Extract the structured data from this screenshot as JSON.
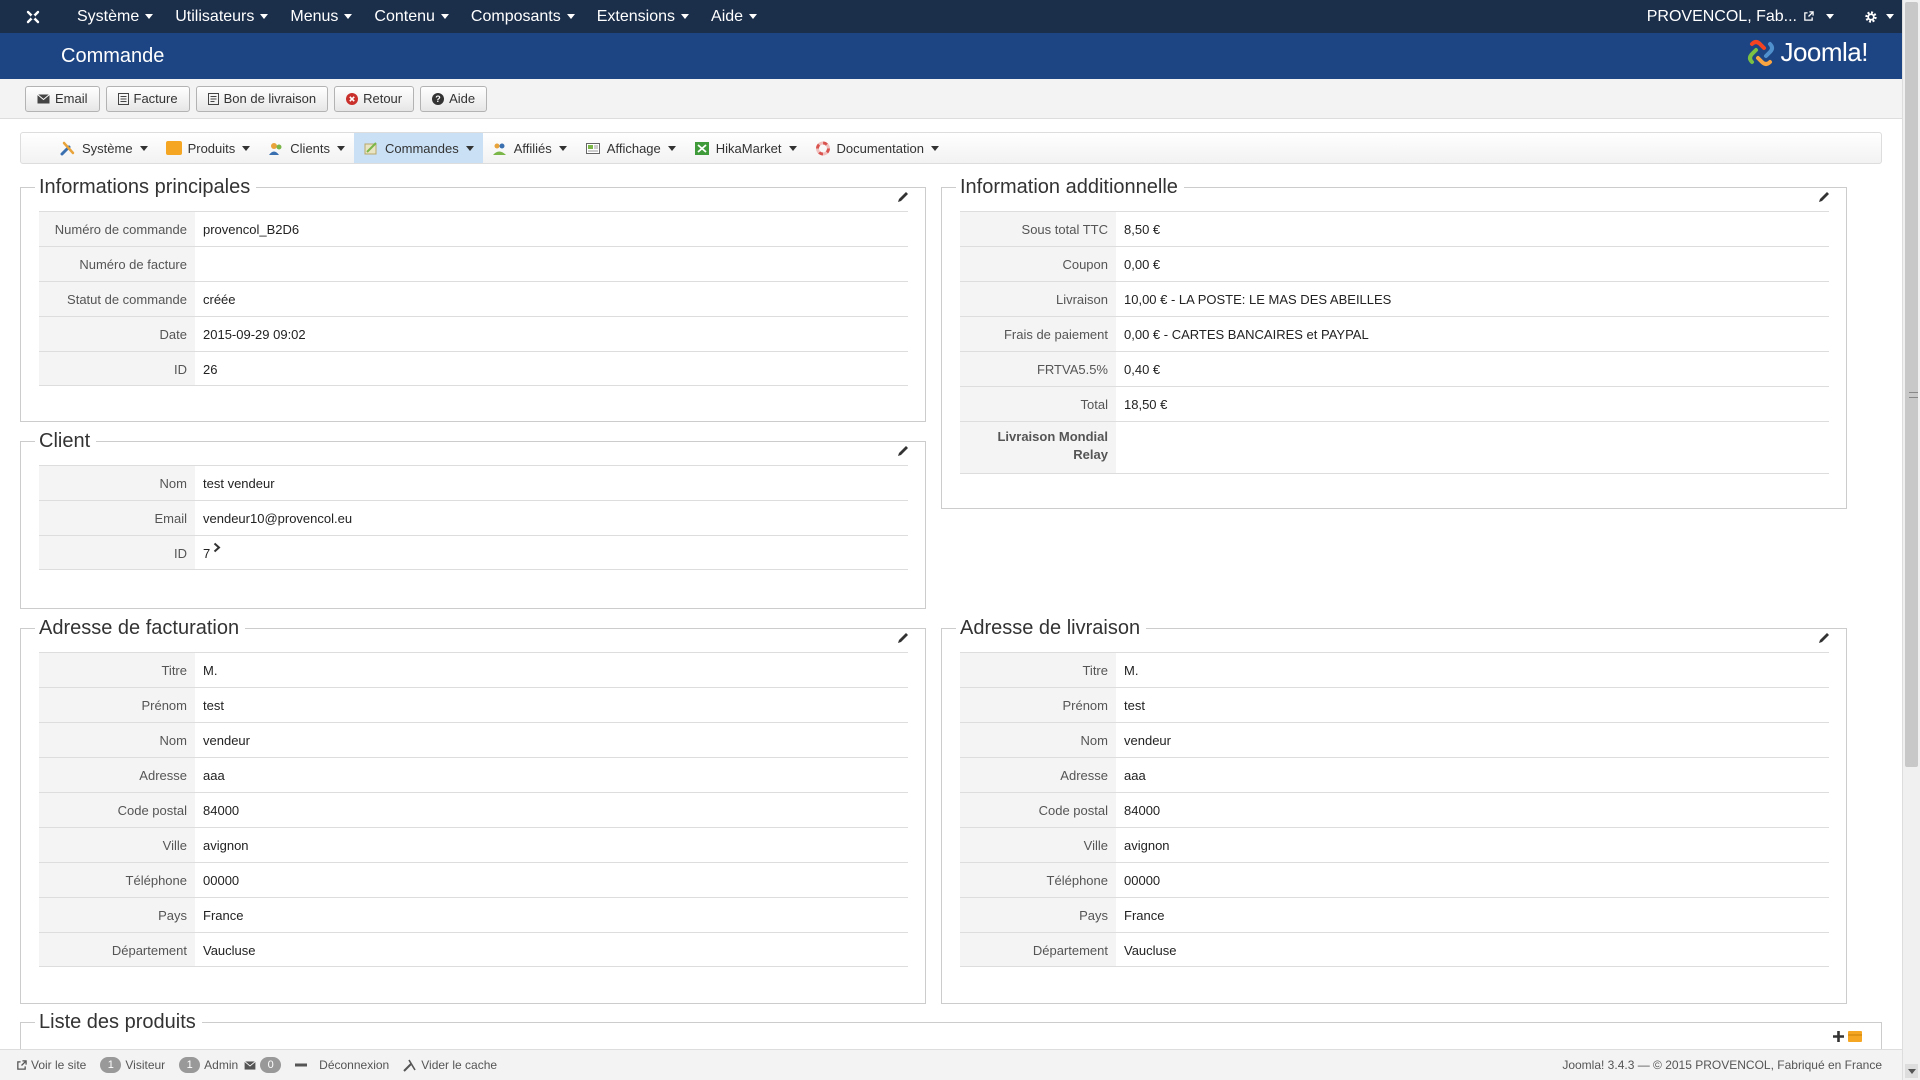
{
  "topbar": {
    "menu": [
      "Système",
      "Utilisateurs",
      "Menus",
      "Contenu",
      "Composants",
      "Extensions",
      "Aide"
    ],
    "user": "PROVENCOL, Fab..."
  },
  "header": {
    "title": "Commande",
    "brand": "Joomla!"
  },
  "toolbar": {
    "email": "Email",
    "invoice": "Facture",
    "delivery": "Bon de livraison",
    "back": "Retour",
    "help": "Aide"
  },
  "hikamenu": {
    "items": [
      "Système",
      "Produits",
      "Clients",
      "Commandes",
      "Affiliés",
      "Affichage",
      "HikaMarket",
      "Documentation"
    ]
  },
  "main_info": {
    "title": "Informations principales",
    "rows": [
      {
        "label": "Numéro de commande",
        "value": "provencol_B2D6"
      },
      {
        "label": "Numéro de facture",
        "value": ""
      },
      {
        "label": "Statut de commande",
        "value": "créée"
      },
      {
        "label": "Date",
        "value": "2015-09-29 09:02"
      },
      {
        "label": "ID",
        "value": "26"
      }
    ]
  },
  "additional": {
    "title": "Information additionnelle",
    "rows": [
      {
        "label": "Sous total TTC",
        "value": "8,50 €"
      },
      {
        "label": "Coupon",
        "value": "0,00 €"
      },
      {
        "label": "Livraison",
        "value": "10,00 € - LA POSTE: LE MAS DES ABEILLES"
      },
      {
        "label": "Frais de paiement",
        "value": "0,00 € - CARTES BANCAIRES et PAYPAL"
      },
      {
        "label": "FRTVA5.5%",
        "value": "0,40 €"
      },
      {
        "label": "Total",
        "value": "18,50 €"
      }
    ],
    "relay_label": "Livraison Mondial Relay"
  },
  "client": {
    "title": "Client",
    "name_label": "Nom",
    "name": "test vendeur",
    "email_label": "Email",
    "email": "vendeur10@provencol.eu",
    "id_label": "ID",
    "id": "7"
  },
  "billing": {
    "title": "Adresse de facturation",
    "rows": [
      {
        "label": "Titre",
        "value": "M."
      },
      {
        "label": "Prénom",
        "value": "test"
      },
      {
        "label": "Nom",
        "value": "vendeur"
      },
      {
        "label": "Adresse",
        "value": "aaa"
      },
      {
        "label": "Code postal",
        "value": "84000"
      },
      {
        "label": "Ville",
        "value": "avignon"
      },
      {
        "label": "Téléphone",
        "value": "00000"
      },
      {
        "label": "Pays",
        "value": "France"
      },
      {
        "label": "Département",
        "value": "Vaucluse"
      }
    ]
  },
  "shipping": {
    "title": "Adresse de livraison",
    "rows": [
      {
        "label": "Titre",
        "value": "M."
      },
      {
        "label": "Prénom",
        "value": "test"
      },
      {
        "label": "Nom",
        "value": "vendeur"
      },
      {
        "label": "Adresse",
        "value": "aaa"
      },
      {
        "label": "Code postal",
        "value": "84000"
      },
      {
        "label": "Ville",
        "value": "avignon"
      },
      {
        "label": "Téléphone",
        "value": "00000"
      },
      {
        "label": "Pays",
        "value": "France"
      },
      {
        "label": "Département",
        "value": "Vaucluse"
      }
    ]
  },
  "products": {
    "title": "Liste des produits"
  },
  "footer": {
    "view_site": "Voir le site",
    "visitors_count": "1",
    "visitors": "Visiteur",
    "admins_count": "1",
    "admins": "Admin",
    "messages_count": "0",
    "logout": "Déconnexion",
    "clear_cache": "Vider le cache",
    "copyright": "Joomla! 3.4.3 — © 2015 PROVENCOL, Fabriqué en France"
  },
  "colors": {
    "topbar": "#1b2e4a",
    "header": "#1e4583",
    "active_menu": "#c9e0f5"
  }
}
